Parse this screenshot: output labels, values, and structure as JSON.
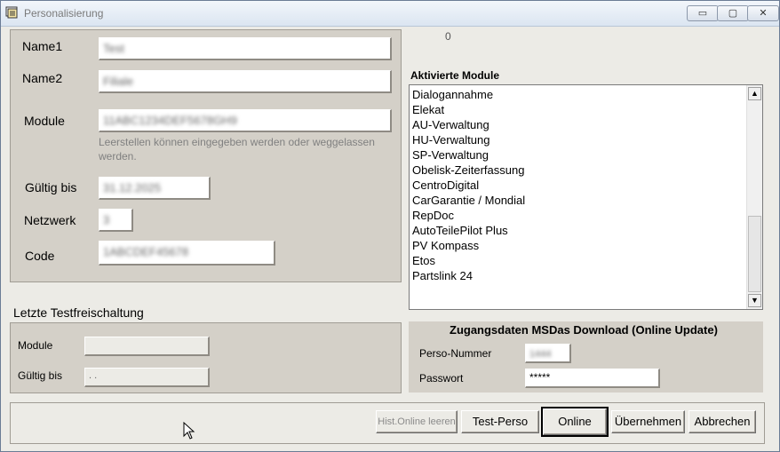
{
  "window": {
    "title": "Personalisierung",
    "minimize": "▭",
    "maximize": "▢",
    "close": "✕"
  },
  "top_counter": "0",
  "perso": {
    "name1_label": "Name1",
    "name1_value": "Test",
    "name2_label": "Name2",
    "name2_value": "Filiale",
    "module_label": "Module",
    "module_value": "11ABC1234DEF5678GH9",
    "module_hint": "Leerstellen können eingegeben werden oder weggelassen werden.",
    "gueltig_label": "Gültig bis",
    "gueltig_value": "31.12.2025",
    "netzwerk_label": "Netzwerk",
    "netzwerk_value": "3",
    "code_label": "Code",
    "code_value": "1ABCDEF45678"
  },
  "testfreischaltung": {
    "heading": "Letzte Testfreischaltung",
    "module_label": "Module",
    "module_value": "",
    "gueltig_label": "Gültig bis",
    "gueltig_value": ". ."
  },
  "aktivierte_module": {
    "heading": "Aktivierte Module",
    "items": [
      "Dialogannahme",
      "Elekat",
      "AU-Verwaltung",
      "HU-Verwaltung",
      "SP-Verwaltung",
      "Obelisk-Zeiterfassung",
      "CentroDigital",
      "CarGarantie / Mondial",
      "RepDoc",
      "AutoTeilePilot Plus",
      "PV Kompass",
      "Etos",
      "Partslink 24"
    ]
  },
  "zugangsdaten": {
    "heading": "Zugangsdaten MSDas Download (Online Update)",
    "perso_label": "Perso-Nummer",
    "perso_value": "1444",
    "passwort_label": "Passwort",
    "passwort_value": "*****"
  },
  "buttons": {
    "hist_online": "Hist.Online leeren",
    "test_perso": "Test-Perso",
    "online": "Online",
    "uebernehmen": "Übernehmen",
    "abbrechen": "Abbrechen"
  }
}
